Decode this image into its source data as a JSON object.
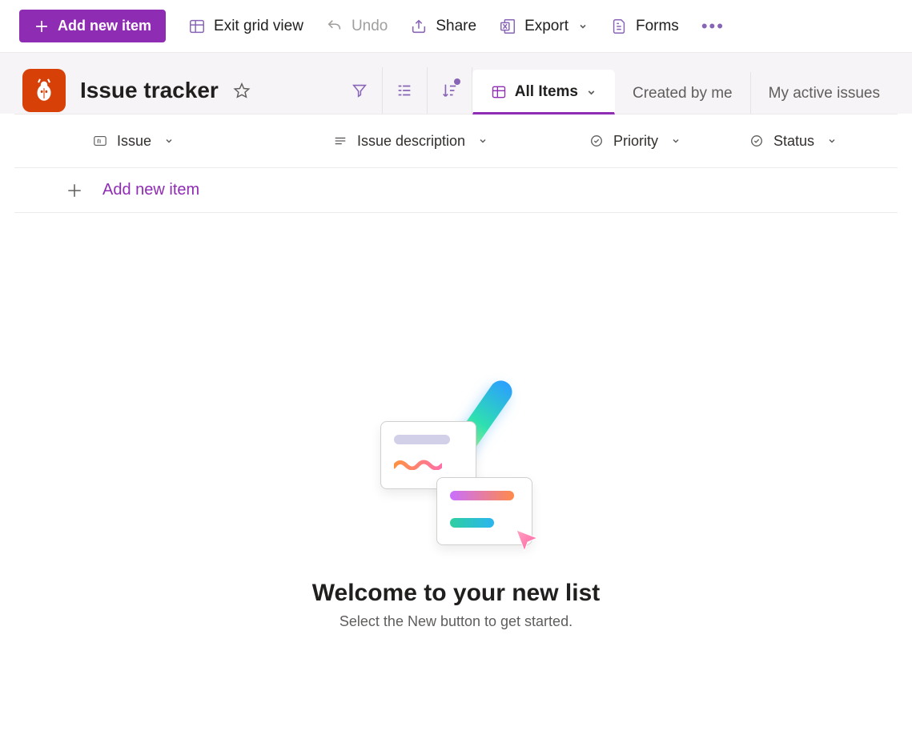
{
  "toolbar": {
    "add_new_label": "Add new item",
    "exit_grid_label": "Exit grid view",
    "undo_label": "Undo",
    "share_label": "Share",
    "export_label": "Export",
    "forms_label": "Forms"
  },
  "list": {
    "title": "Issue tracker"
  },
  "views": [
    {
      "label": "All Items",
      "active": true
    },
    {
      "label": "Created by me",
      "active": false
    },
    {
      "label": "My active issues",
      "active": false
    }
  ],
  "columns": [
    {
      "label": "Issue",
      "icon": "text"
    },
    {
      "label": "Issue description",
      "icon": "multiline"
    },
    {
      "label": "Priority",
      "icon": "choice"
    },
    {
      "label": "Status",
      "icon": "choice"
    }
  ],
  "grid": {
    "add_row_label": "Add new item"
  },
  "empty_state": {
    "title": "Welcome to your new list",
    "subtitle": "Select the New button to get started."
  }
}
